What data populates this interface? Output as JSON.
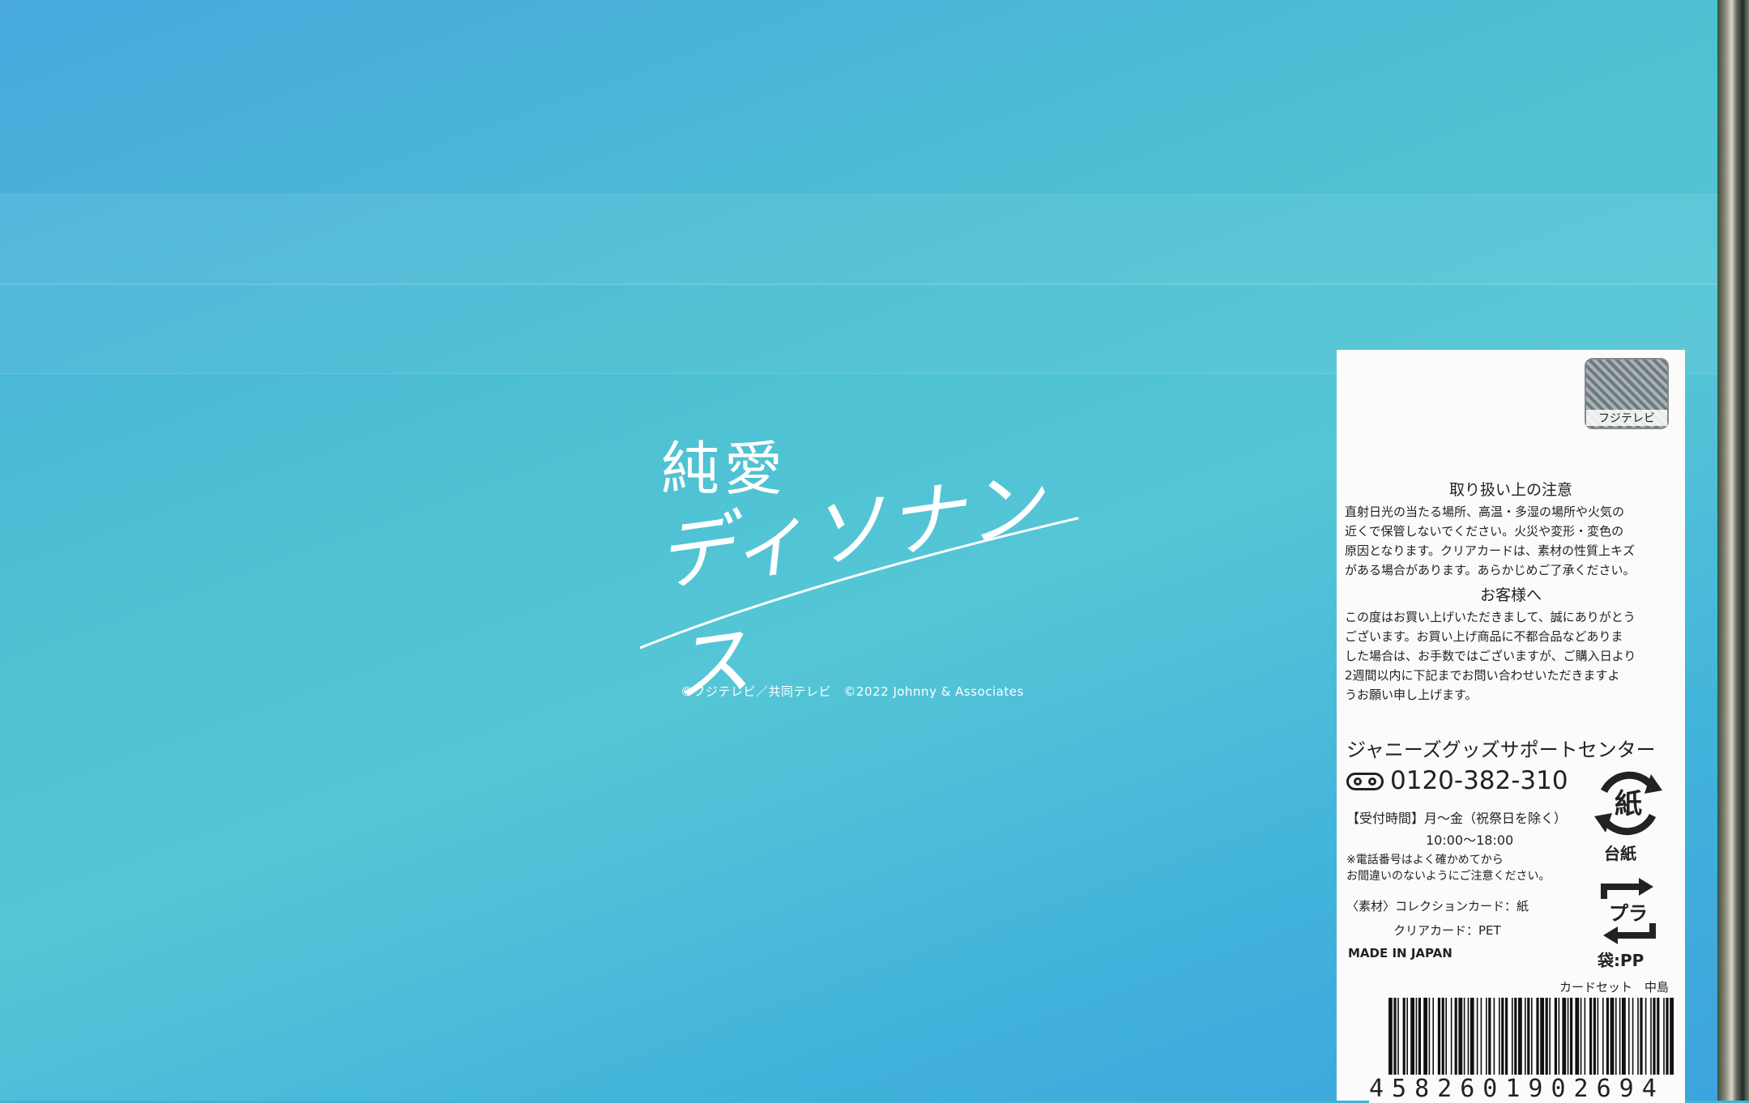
{
  "title": {
    "line1": "純愛",
    "line2": "ディソナンス"
  },
  "copyright": "©フジテレビ／共同テレビ　©2022 Johnny & Associates",
  "label": {
    "hologram_text": "フジテレビ",
    "caution_heading": "取り扱い上の注意",
    "caution_lines": [
      "直射日光の当たる場所、高温・多湿の場所や火気の",
      "近くで保管しないでください。火災や変形・変色の",
      "原因となります。クリアカードは、素材の性質上キズ",
      "がある場合があります。あらかじめご了承ください。"
    ],
    "customer_heading": "お客様へ",
    "customer_lines": [
      "この度はお買い上げいただきまして、誠にありがとう",
      "ございます。お買い上げ商品に不都合品などありま",
      "した場合は、お手数ではございますが、ご購入日より",
      "2週間以内に下記までお問い合わせいただきますよ",
      "うお願い申し上げます。"
    ],
    "support_name": "ジャニーズグッズサポートセンター",
    "phone": "0120-382-310",
    "hours": "【受付時間】月〜金（祝祭日を除く）",
    "hours_time": "10:00〜18:00",
    "note_lines": [
      "※電話番号はよく確かめてから",
      "お間違いのないようにご注意ください。"
    ],
    "material_1": "〈素材〉コレクションカード：紙",
    "material_2": "クリアカード：PET",
    "made_in": "MADE IN JAPAN",
    "recycle_paper_mark": "紙",
    "recycle_paper_label": "台紙",
    "recycle_pla_mark": "プラ",
    "recycle_pla_label": "袋:PP",
    "product": "カードセット　中島",
    "barcode_digits": "4582601902694"
  }
}
